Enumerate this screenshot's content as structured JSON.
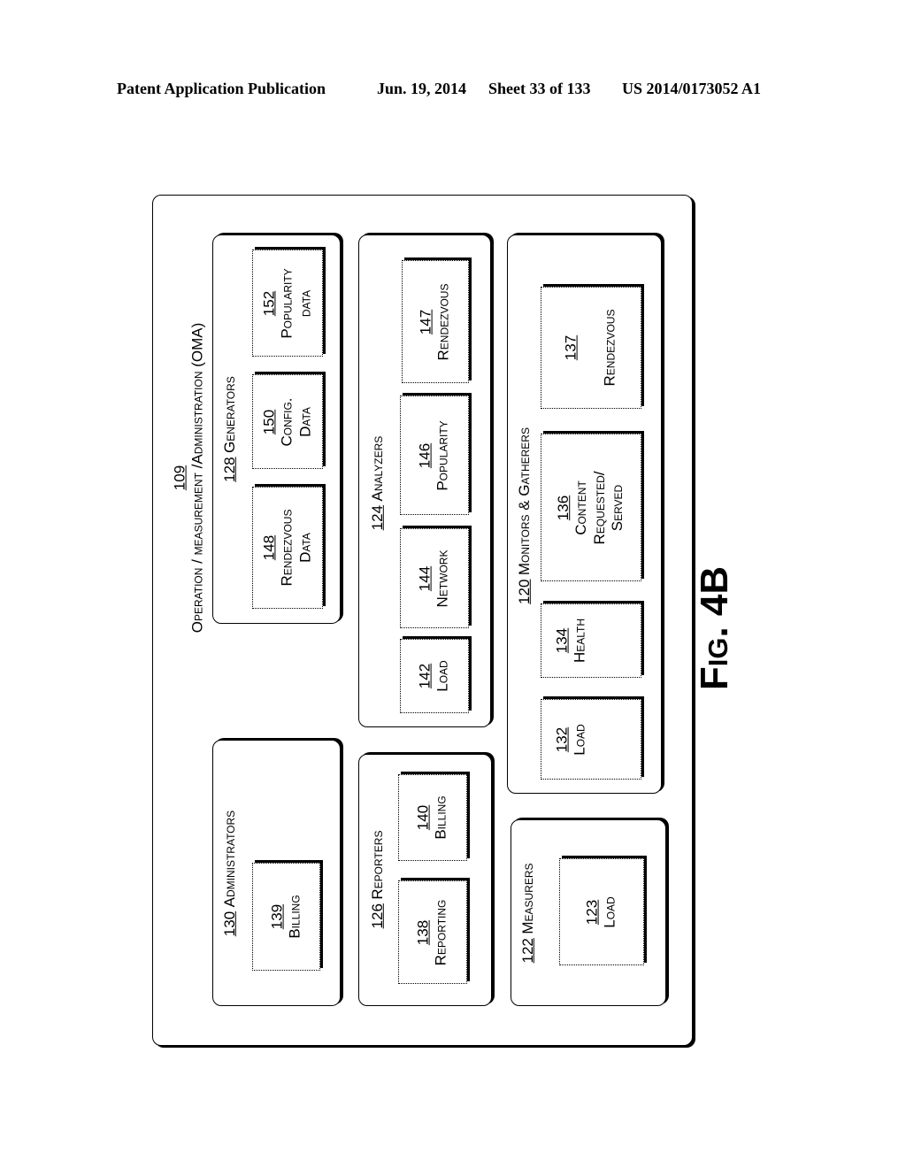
{
  "header": {
    "publication": "Patent Application Publication",
    "date": "Jun. 19, 2014",
    "sheet": "Sheet 33 of 133",
    "patent_number": "US 2014/0173052 A1"
  },
  "figure_label": "Fig. 4B",
  "oma": {
    "ref": "109",
    "title": "Operation / measurement /Administration (OMA)"
  },
  "groups": {
    "generators": {
      "ref": "128",
      "label": "Generators",
      "items": [
        {
          "ref": "148",
          "line1": "Rendezvous",
          "line2": "Data"
        },
        {
          "ref": "150",
          "line1": "Config.",
          "line2": "Data"
        },
        {
          "ref": "152",
          "line1": "Popularity",
          "line2": "data"
        }
      ]
    },
    "administrators": {
      "ref": "130",
      "label": "Administrators",
      "items": [
        {
          "ref": "139",
          "line1": "Billing"
        }
      ]
    },
    "analyzers": {
      "ref": "124",
      "label": "Analyzers",
      "items": [
        {
          "ref": "142",
          "line1": "Load"
        },
        {
          "ref": "144",
          "line1": "Network"
        },
        {
          "ref": "146",
          "line1": "Popularity"
        },
        {
          "ref": "147",
          "line1": "Rendezvous"
        }
      ]
    },
    "reporters": {
      "ref": "126",
      "label": "Reporters",
      "items": [
        {
          "ref": "138",
          "line1": "Reporting"
        },
        {
          "ref": "140",
          "line1": "Billing"
        }
      ]
    },
    "monitors": {
      "ref": "120",
      "label": "Monitors & Gatherers",
      "items": [
        {
          "ref": "132",
          "line1": "Load"
        },
        {
          "ref": "134",
          "line1": "Health"
        },
        {
          "ref": "136",
          "line1": "Content",
          "line2": "Requested/",
          "line3": "Served"
        },
        {
          "ref": "137",
          "line1": "Rendezvous"
        }
      ]
    },
    "measurers": {
      "ref": "122",
      "label": "Measurers",
      "items": [
        {
          "ref": "123",
          "line1": "Load"
        }
      ]
    }
  }
}
